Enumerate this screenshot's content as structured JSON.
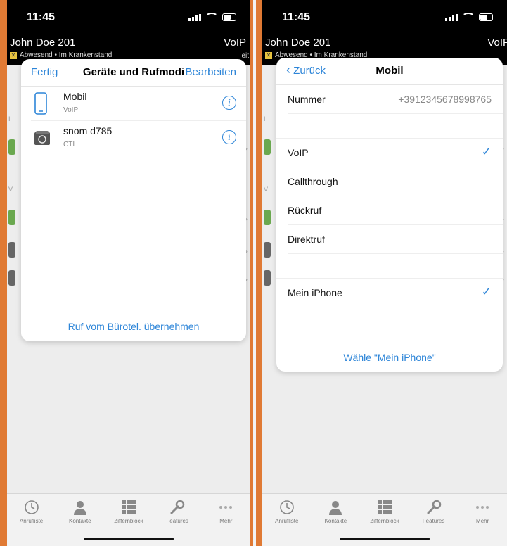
{
  "status": {
    "time": "11:45"
  },
  "header": {
    "user": "John Doe 201",
    "mode": "VoIP",
    "status_line": "Abwesend • Im Krankenstand",
    "edge_text": "eit"
  },
  "screen1": {
    "nav": {
      "left": "Fertig",
      "title": "Geräte und Rufmodi",
      "right": "Bearbeiten"
    },
    "devices": [
      {
        "name": "Mobil",
        "sub": "VoIP",
        "icon": "mobile-phone-icon"
      },
      {
        "name": "snom d785",
        "sub": "CTI",
        "icon": "desk-phone-icon"
      }
    ],
    "footer_link": "Ruf vom Bürotel. übernehmen"
  },
  "screen2": {
    "nav": {
      "left": "Zurück",
      "title": "Mobil"
    },
    "number": {
      "label": "Nummer",
      "value": "+3912345678998765"
    },
    "modes": [
      {
        "label": "VoIP",
        "checked": true
      },
      {
        "label": "Callthrough",
        "checked": false
      },
      {
        "label": "Rückruf",
        "checked": false
      },
      {
        "label": "Direktruf",
        "checked": false
      }
    ],
    "device": {
      "label": "Mein iPhone",
      "checked": true
    },
    "footer_link": "Wähle \"Mein iPhone\""
  },
  "tabbar": [
    {
      "label": "Anrufliste",
      "icon": "clock-icon"
    },
    {
      "label": "Kontakte",
      "icon": "person-icon"
    },
    {
      "label": "Ziffernblock",
      "icon": "keypad-icon"
    },
    {
      "label": "Features",
      "icon": "wrench-icon"
    },
    {
      "label": "Mehr",
      "icon": "more-dots-icon"
    }
  ],
  "colors": {
    "accent": "#2d85d8",
    "border": "#e07a34",
    "header_bg": "#000000"
  }
}
